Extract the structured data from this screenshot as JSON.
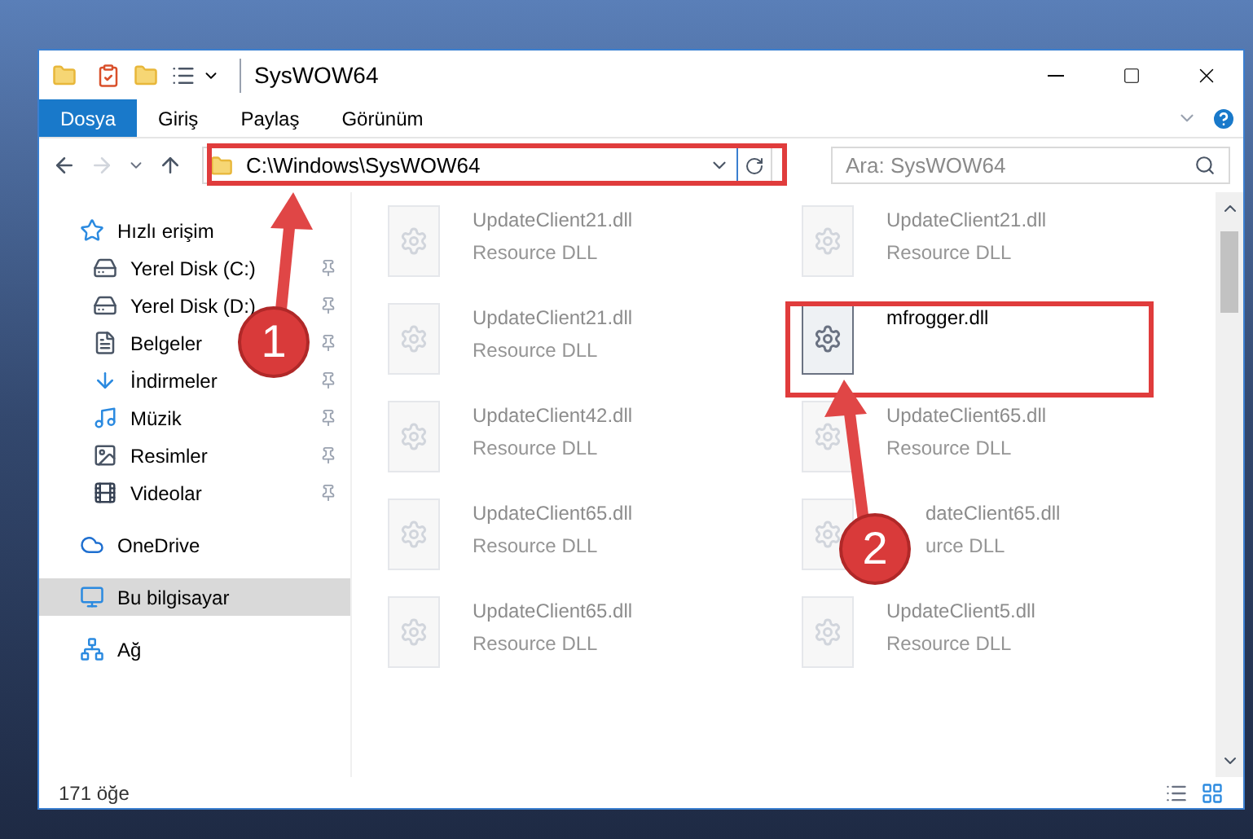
{
  "window": {
    "title": "SysWOW64"
  },
  "ribbon_tabs": [
    {
      "label": "Dosya",
      "selected": true
    },
    {
      "label": "Giriş",
      "selected": false
    },
    {
      "label": "Paylaş",
      "selected": false
    },
    {
      "label": "Görünüm",
      "selected": false
    }
  ],
  "address": {
    "path": "C:\\Windows\\SysWOW64"
  },
  "search": {
    "placeholder": "Ara: SysWOW64"
  },
  "sidebar": {
    "items": [
      {
        "label": "Hızlı erişim",
        "kind": "star",
        "selected": false,
        "children": [
          {
            "label": "Yerel Disk (C:)",
            "kind": "disk",
            "pinned": true
          },
          {
            "label": "Yerel Disk (D:)",
            "kind": "disk",
            "pinned": true
          },
          {
            "label": "Belgeler",
            "kind": "doc",
            "pinned": true
          },
          {
            "label": "İndirmeler",
            "kind": "download",
            "pinned": true
          },
          {
            "label": "Müzik",
            "kind": "music",
            "pinned": true
          },
          {
            "label": "Resimler",
            "kind": "image",
            "pinned": true
          },
          {
            "label": "Videolar",
            "kind": "video",
            "pinned": true
          }
        ]
      },
      {
        "label": "OneDrive",
        "kind": "cloud",
        "selected": false
      },
      {
        "label": "Bu bilgisayar",
        "kind": "pc",
        "selected": true
      },
      {
        "label": "Ağ",
        "kind": "network",
        "selected": false
      }
    ]
  },
  "files": [
    {
      "name": "UpdateClient21.dll",
      "type": "Resource DLL",
      "emphasized": false
    },
    {
      "name": "UpdateClient21.dll",
      "type": "Resource DLL",
      "emphasized": false
    },
    {
      "name": "UpdateClient21.dll",
      "type": "Resource DLL",
      "emphasized": false
    },
    {
      "name": "mfrogger.dll",
      "emphasized": true
    },
    {
      "name": "UpdateClient42.dll",
      "type": "Resource DLL",
      "emphasized": false
    },
    {
      "name": "UpdateClient65.dll",
      "type": "Resource DLL",
      "emphasized": false
    },
    {
      "name": "UpdateClient65.dll",
      "type": "Resource DLL",
      "emphasized": false
    },
    {
      "name": "dateClient65.dll",
      "type": "urce DLL",
      "emphasized": false,
      "obscured": true
    },
    {
      "name": "UpdateClient65.dll",
      "type": "Resource DLL",
      "emphasized": false
    },
    {
      "name": "UpdateClient5.dll",
      "type": "Resource DLL",
      "emphasized": false
    }
  ],
  "status_bar": {
    "count": "171 öğe"
  },
  "annotations": [
    {
      "number": "1"
    },
    {
      "number": "2"
    }
  ]
}
